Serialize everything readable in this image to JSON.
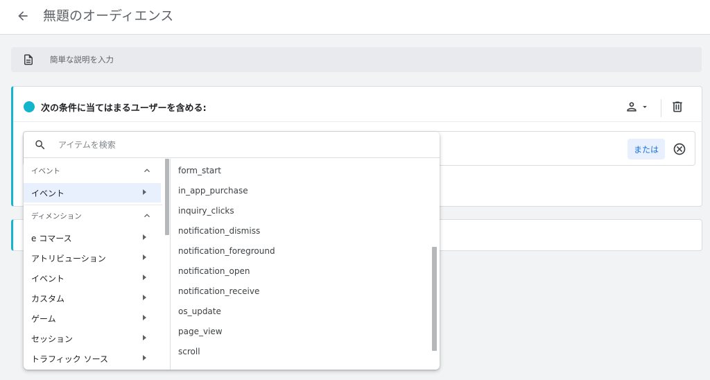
{
  "header": {
    "title": "無題のオーディエンス",
    "back_icon": "arrow-back-icon"
  },
  "description": {
    "placeholder": "簡単な説明を入力",
    "icon": "document-icon"
  },
  "condition_group": {
    "title": "次の条件に当てはまるユーザーを含める:",
    "accent_color": "#12b5cb",
    "scope_icon": "person-icon",
    "delete_icon": "trash-icon",
    "or_label": "または",
    "remove_icon": "close-circle-icon"
  },
  "picker": {
    "search_placeholder": "アイテムを検索",
    "sections": [
      {
        "header": "イベント",
        "items": [
          {
            "label": "イベント",
            "selected": true
          }
        ]
      },
      {
        "header": "ディメンション",
        "items": [
          {
            "label": "e コマース"
          },
          {
            "label": "アトリビューション"
          },
          {
            "label": "イベント"
          },
          {
            "label": "カスタム"
          },
          {
            "label": "ゲーム"
          },
          {
            "label": "セッション"
          },
          {
            "label": "トラフィック ソース"
          }
        ]
      }
    ],
    "events": [
      "form_start",
      "in_app_purchase",
      "inquiry_clicks",
      "notification_dismiss",
      "notification_foreground",
      "notification_open",
      "notification_receive",
      "os_update",
      "page_view",
      "scroll"
    ]
  }
}
